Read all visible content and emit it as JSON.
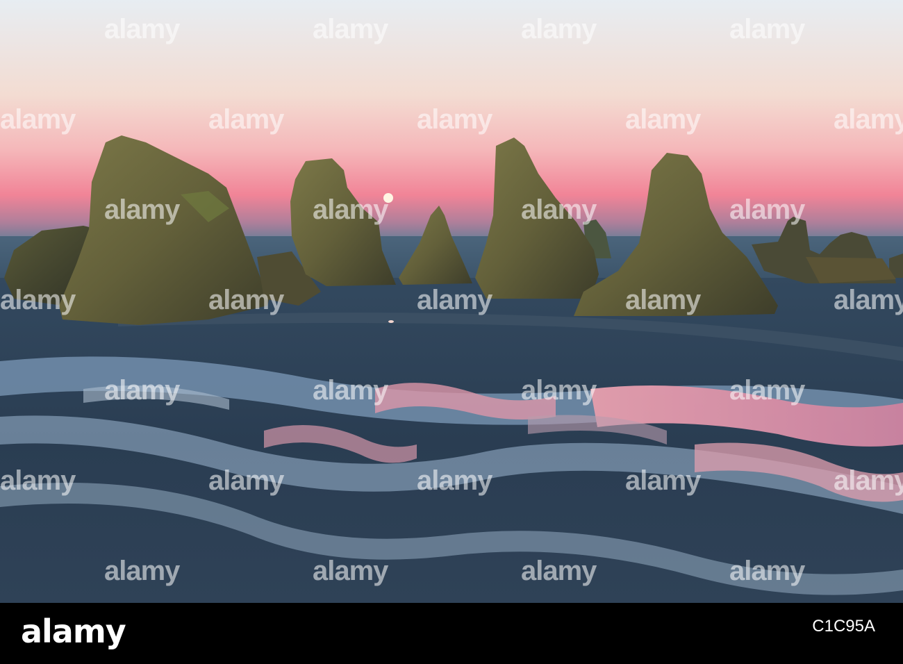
{
  "photo": {
    "description_icon": "seascape-photo",
    "sky_colors": [
      "#e9ecf0",
      "#f2d6d0",
      "#f3a8b0",
      "#f27e92",
      "#5f7e96"
    ],
    "water_colors": [
      "#2b3f56",
      "#6f8aa8",
      "#f1a3b2"
    ],
    "rock_color": "#6b6a3f",
    "moon_color": "#fff7e6"
  },
  "watermark": {
    "text": "alamy",
    "color": "#ffffff"
  },
  "footer": {
    "logo_text": "alamy",
    "image_id": "C1C95A",
    "background": "#000000"
  }
}
